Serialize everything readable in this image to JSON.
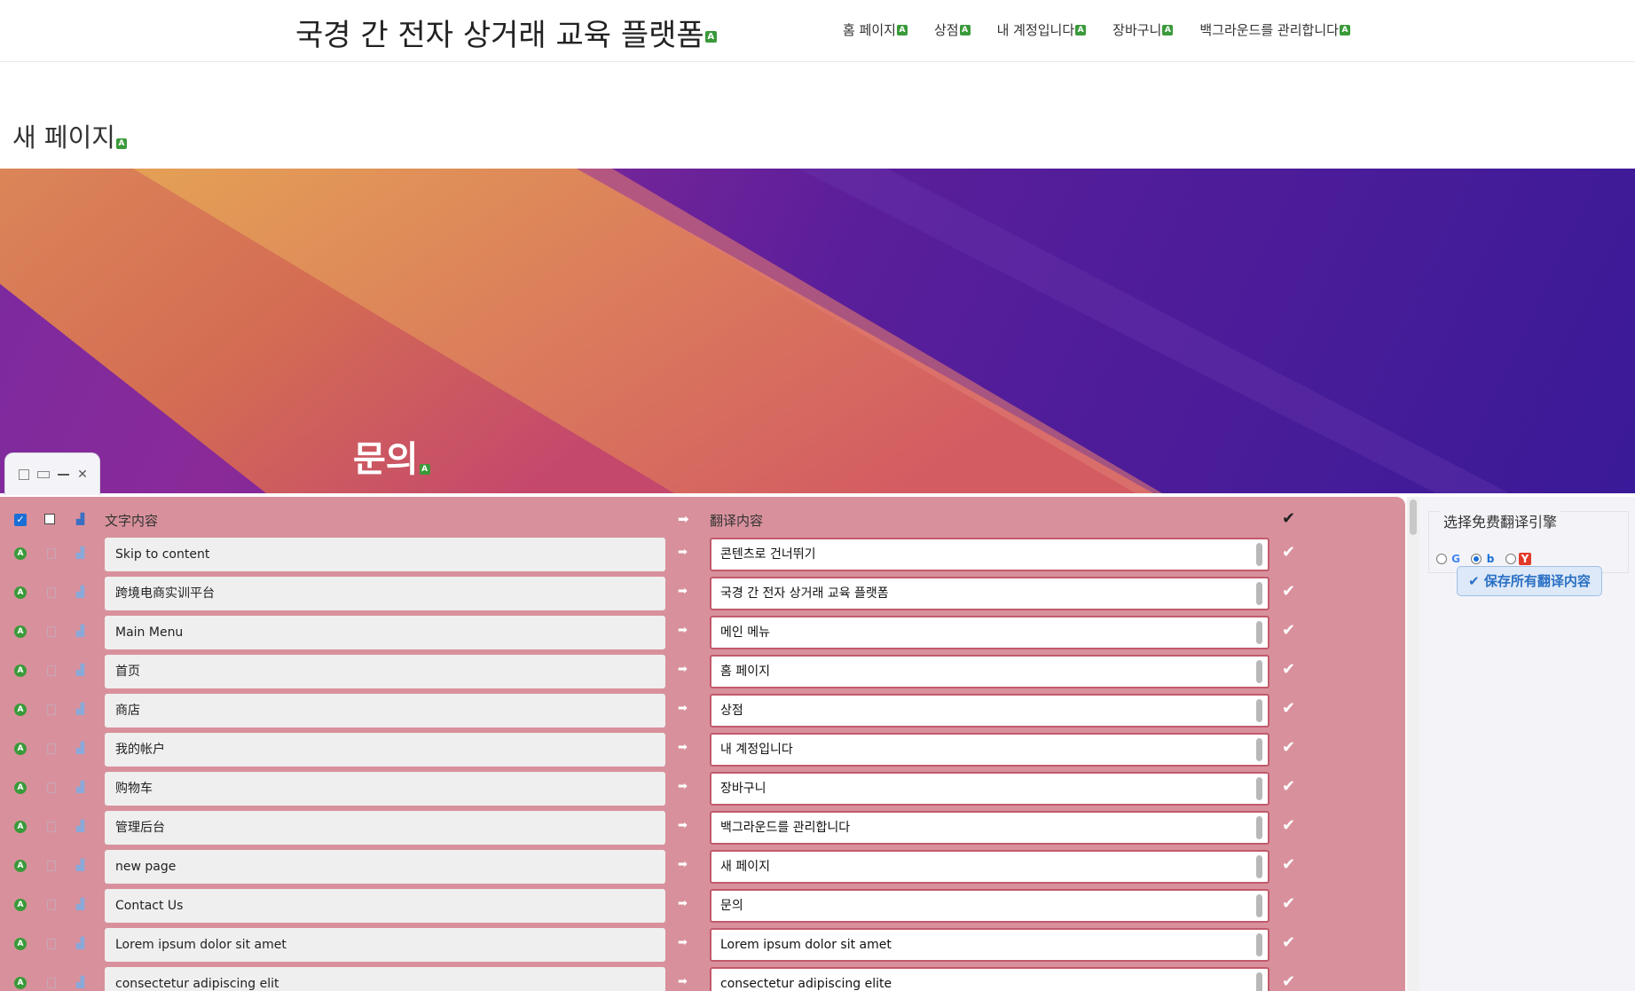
{
  "header": {
    "site_title": "국경 간 전자 상거래 교육 플랫폼",
    "nav": [
      {
        "label": "홈 페이지"
      },
      {
        "label": "상점"
      },
      {
        "label": "내 계정입니다"
      },
      {
        "label": "장바구니"
      },
      {
        "label": "백그라운드를 관리합니다"
      }
    ]
  },
  "page": {
    "title": "새 페이지"
  },
  "hero": {
    "heading": "문의"
  },
  "translator": {
    "source_header": "文字内容",
    "target_header": "翻译内容",
    "arrow_icon": "arrow-right-icon",
    "rows": [
      {
        "source": "Skip to content",
        "target": "콘텐츠로 건너뛰기"
      },
      {
        "source": "跨境电商实训平台",
        "target": "국경 간 전자 상거래 교육 플랫폼"
      },
      {
        "source": "Main Menu",
        "target": "메인 메뉴"
      },
      {
        "source": "首页",
        "target": "홈 페이지"
      },
      {
        "source": "商店",
        "target": "상점"
      },
      {
        "source": "我的帐户",
        "target": "내 계정입니다"
      },
      {
        "source": "购物车",
        "target": "장바구니"
      },
      {
        "source": "管理后台",
        "target": "백그라운드를 관리합니다"
      },
      {
        "source": "new page",
        "target": "새 페이지"
      },
      {
        "source": "Contact Us",
        "target": "문의"
      },
      {
        "source": "Lorem ipsum dolor sit amet",
        "target": "Lorem ipsum dolor sit amet"
      },
      {
        "source": "consectetur adipiscing elit",
        "target": "consectetur adipiscing elite"
      }
    ]
  },
  "engine_panel": {
    "legend": "选择免费翻译引擎",
    "engines": [
      {
        "name": "google",
        "glyph": "G",
        "color": "#4285f4",
        "selected": false
      },
      {
        "name": "bing",
        "glyph": "b",
        "color": "#1a6fd6",
        "selected": true
      },
      {
        "name": "youdao",
        "glyph": "Y",
        "color": "#e23a2a",
        "selected": false
      }
    ],
    "save_label": "✔ 保存所有翻译内容"
  },
  "colors": {
    "panel_bg": "#d8919c",
    "badge_green": "#3a9a3a",
    "accent_blue": "#1a6fd6"
  }
}
